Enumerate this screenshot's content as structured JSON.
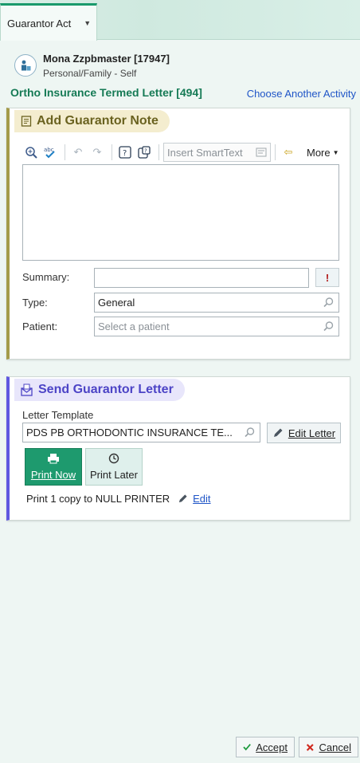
{
  "tab": {
    "label": "Guarantor Act"
  },
  "patient": {
    "name": "Mona Zzpbmaster [17947]",
    "relationship": "Personal/Family - Self"
  },
  "activity": {
    "title": "Ortho Insurance Termed Letter [494]",
    "choose_link": "Choose Another Activity"
  },
  "note_card": {
    "title": "Add Guarantor Note",
    "toolbar": {
      "smarttext_placeholder": "Insert SmartText",
      "more_label": "More"
    },
    "note_text": "",
    "summary": {
      "label": "Summary:",
      "value": ""
    },
    "type": {
      "label": "Type:",
      "value": "General"
    },
    "patient": {
      "label": "Patient:",
      "placeholder": "Select a patient"
    }
  },
  "letter_card": {
    "title": "Send Guarantor Letter",
    "template_label": "Letter Template",
    "template_value": "PDS PB ORTHODONTIC INSURANCE TE...",
    "edit_letter_label": "Edit Letter",
    "print_now_label": "Print Now",
    "print_later_label": "Print Later",
    "print_info": "Print 1 copy to NULL PRINTER",
    "edit_label": "Edit"
  },
  "footer": {
    "accept_label": "Accept",
    "cancel_label": "Cancel"
  },
  "colors": {
    "accent": "#1e9a6e",
    "note_accent": "#a49b4a",
    "letter_accent": "#6058e0",
    "link": "#1f55c7"
  }
}
